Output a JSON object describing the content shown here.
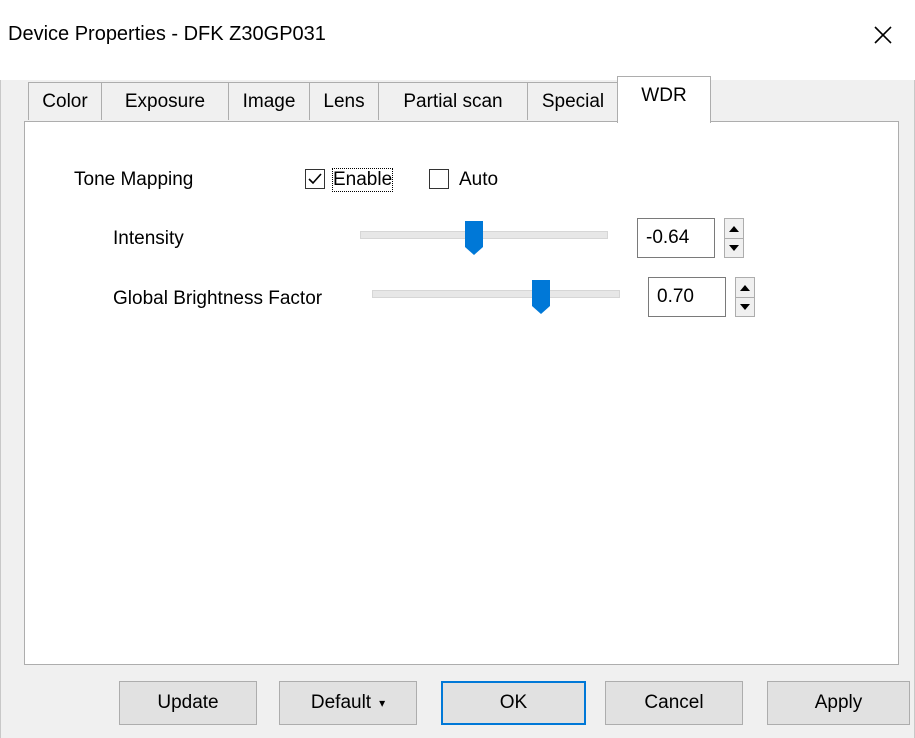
{
  "window": {
    "title": "Device Properties - DFK Z30GP031",
    "close_glyph": "✕"
  },
  "tabs": [
    {
      "label": "Color"
    },
    {
      "label": "Exposure"
    },
    {
      "label": "Image"
    },
    {
      "label": "Lens"
    },
    {
      "label": "Partial scan"
    },
    {
      "label": "Special"
    },
    {
      "label": "WDR",
      "selected": true
    }
  ],
  "wdr": {
    "tone_mapping_label": "Tone Mapping",
    "enable": {
      "label": "Enable",
      "checked": true
    },
    "auto": {
      "label": "Auto",
      "checked": false
    },
    "intensity": {
      "label": "Intensity",
      "value": "-0.64",
      "slider_fraction": 0.47
    },
    "global_brightness": {
      "label": "Global Brightness Factor",
      "value": "0.70",
      "slider_fraction": 0.68
    }
  },
  "buttons": {
    "update": "Update",
    "default": "Default",
    "default_arrow": "▾",
    "ok": "OK",
    "cancel": "Cancel",
    "apply": "Apply"
  },
  "colors": {
    "accent": "#0078d7",
    "window_bg": "#f0f0f0",
    "page_bg": "#ffffff"
  }
}
